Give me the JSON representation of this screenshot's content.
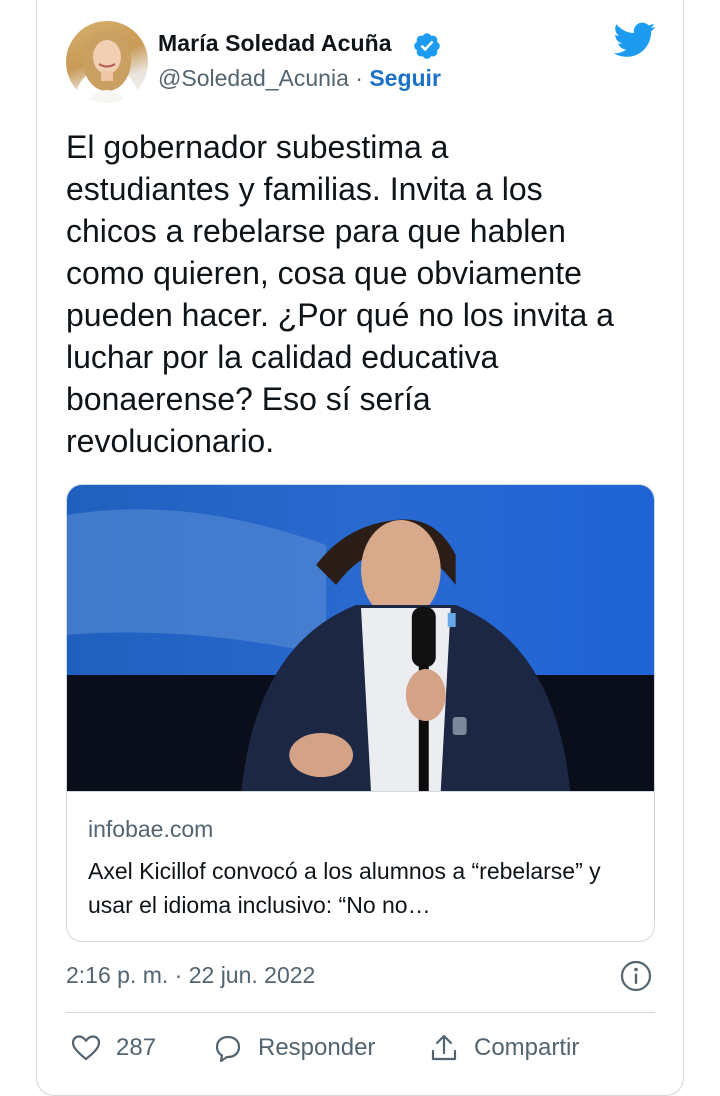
{
  "author": {
    "name": "María Soledad Acuña",
    "handle": "@Soledad_Acunia",
    "separator": "·",
    "follow_label": "Seguir"
  },
  "tweet": {
    "text": "El gobernador subestima a\nestudiantes y familias. Invita a los\nchicos a rebelarse para que hablen\ncomo quieren, cosa que obviamente\npueden hacer. ¿Por qué no los invita a\nluchar por la calidad educativa\nbonaerense? Eso sí sería\nrevolucionario."
  },
  "link_card": {
    "domain": "infobae.com",
    "title": "Axel Kicillof convocó a los alumnos a “rebelarse” y usar el idioma inclusivo: “No no…"
  },
  "meta": {
    "timestamp": "2:16 p. m. · 22 jun. 2022"
  },
  "actions": {
    "like_count": "287",
    "reply_label": "Responder",
    "share_label": "Compartir"
  },
  "icons": {
    "verified": "verified-badge-icon",
    "logo": "twitter-bird-icon",
    "info": "info-icon",
    "like": "heart-icon",
    "reply": "speech-bubble-icon",
    "share": "share-upload-icon"
  },
  "colors": {
    "brand": "#1d9bf0",
    "follow": "#1d72c8",
    "text": "#0f1419",
    "secondary": "#536471",
    "border": "#cfd9de"
  }
}
